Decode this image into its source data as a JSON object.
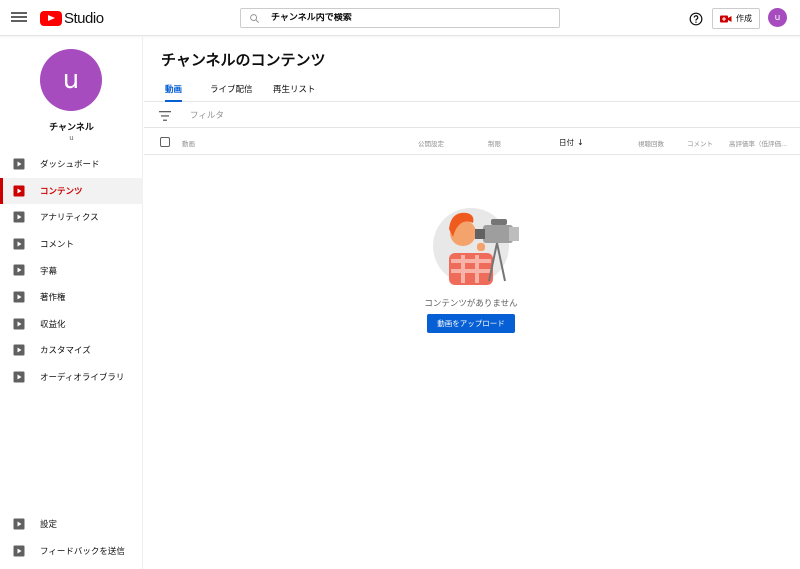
{
  "header": {
    "logo_text": "Studio",
    "search": {
      "placeholder": "チャンネル内で検索"
    },
    "create_label": "作成",
    "avatar_letter": "u"
  },
  "sidebar": {
    "avatar_letter": "u",
    "channel_title": "チャンネル",
    "channel_handle": "u",
    "items": [
      {
        "label": "ダッシュボード",
        "active": false
      },
      {
        "label": "コンテンツ",
        "active": true
      },
      {
        "label": "アナリティクス",
        "active": false
      },
      {
        "label": "コメント",
        "active": false
      },
      {
        "label": "字幕",
        "active": false
      },
      {
        "label": "著作権",
        "active": false
      },
      {
        "label": "収益化",
        "active": false
      },
      {
        "label": "カスタマイズ",
        "active": false
      },
      {
        "label": "オーディオライブラリ",
        "active": false
      }
    ],
    "bottom_items": [
      {
        "label": "設定"
      },
      {
        "label": "フィードバックを送信"
      }
    ]
  },
  "main": {
    "title": "チャンネルのコンテンツ",
    "tabs": [
      {
        "label": "動画",
        "active": true
      },
      {
        "label": "ライブ配信",
        "active": false
      },
      {
        "label": "再生リスト",
        "active": false
      }
    ],
    "filter": {
      "placeholder": "フィルタ"
    },
    "columns": [
      "動画",
      "公開設定",
      "制限",
      "日付",
      "視聴回数",
      "コメント",
      "高評価率（低評価..."
    ],
    "sorted_arrow": "↓",
    "empty": {
      "message": "コンテンツがありません",
      "upload_label": "動画をアップロード"
    }
  },
  "colors": {
    "accent": "#065fd4",
    "active_red": "#cc0000",
    "avatar": "#a64cbf",
    "brand_red": "#ff0000"
  }
}
